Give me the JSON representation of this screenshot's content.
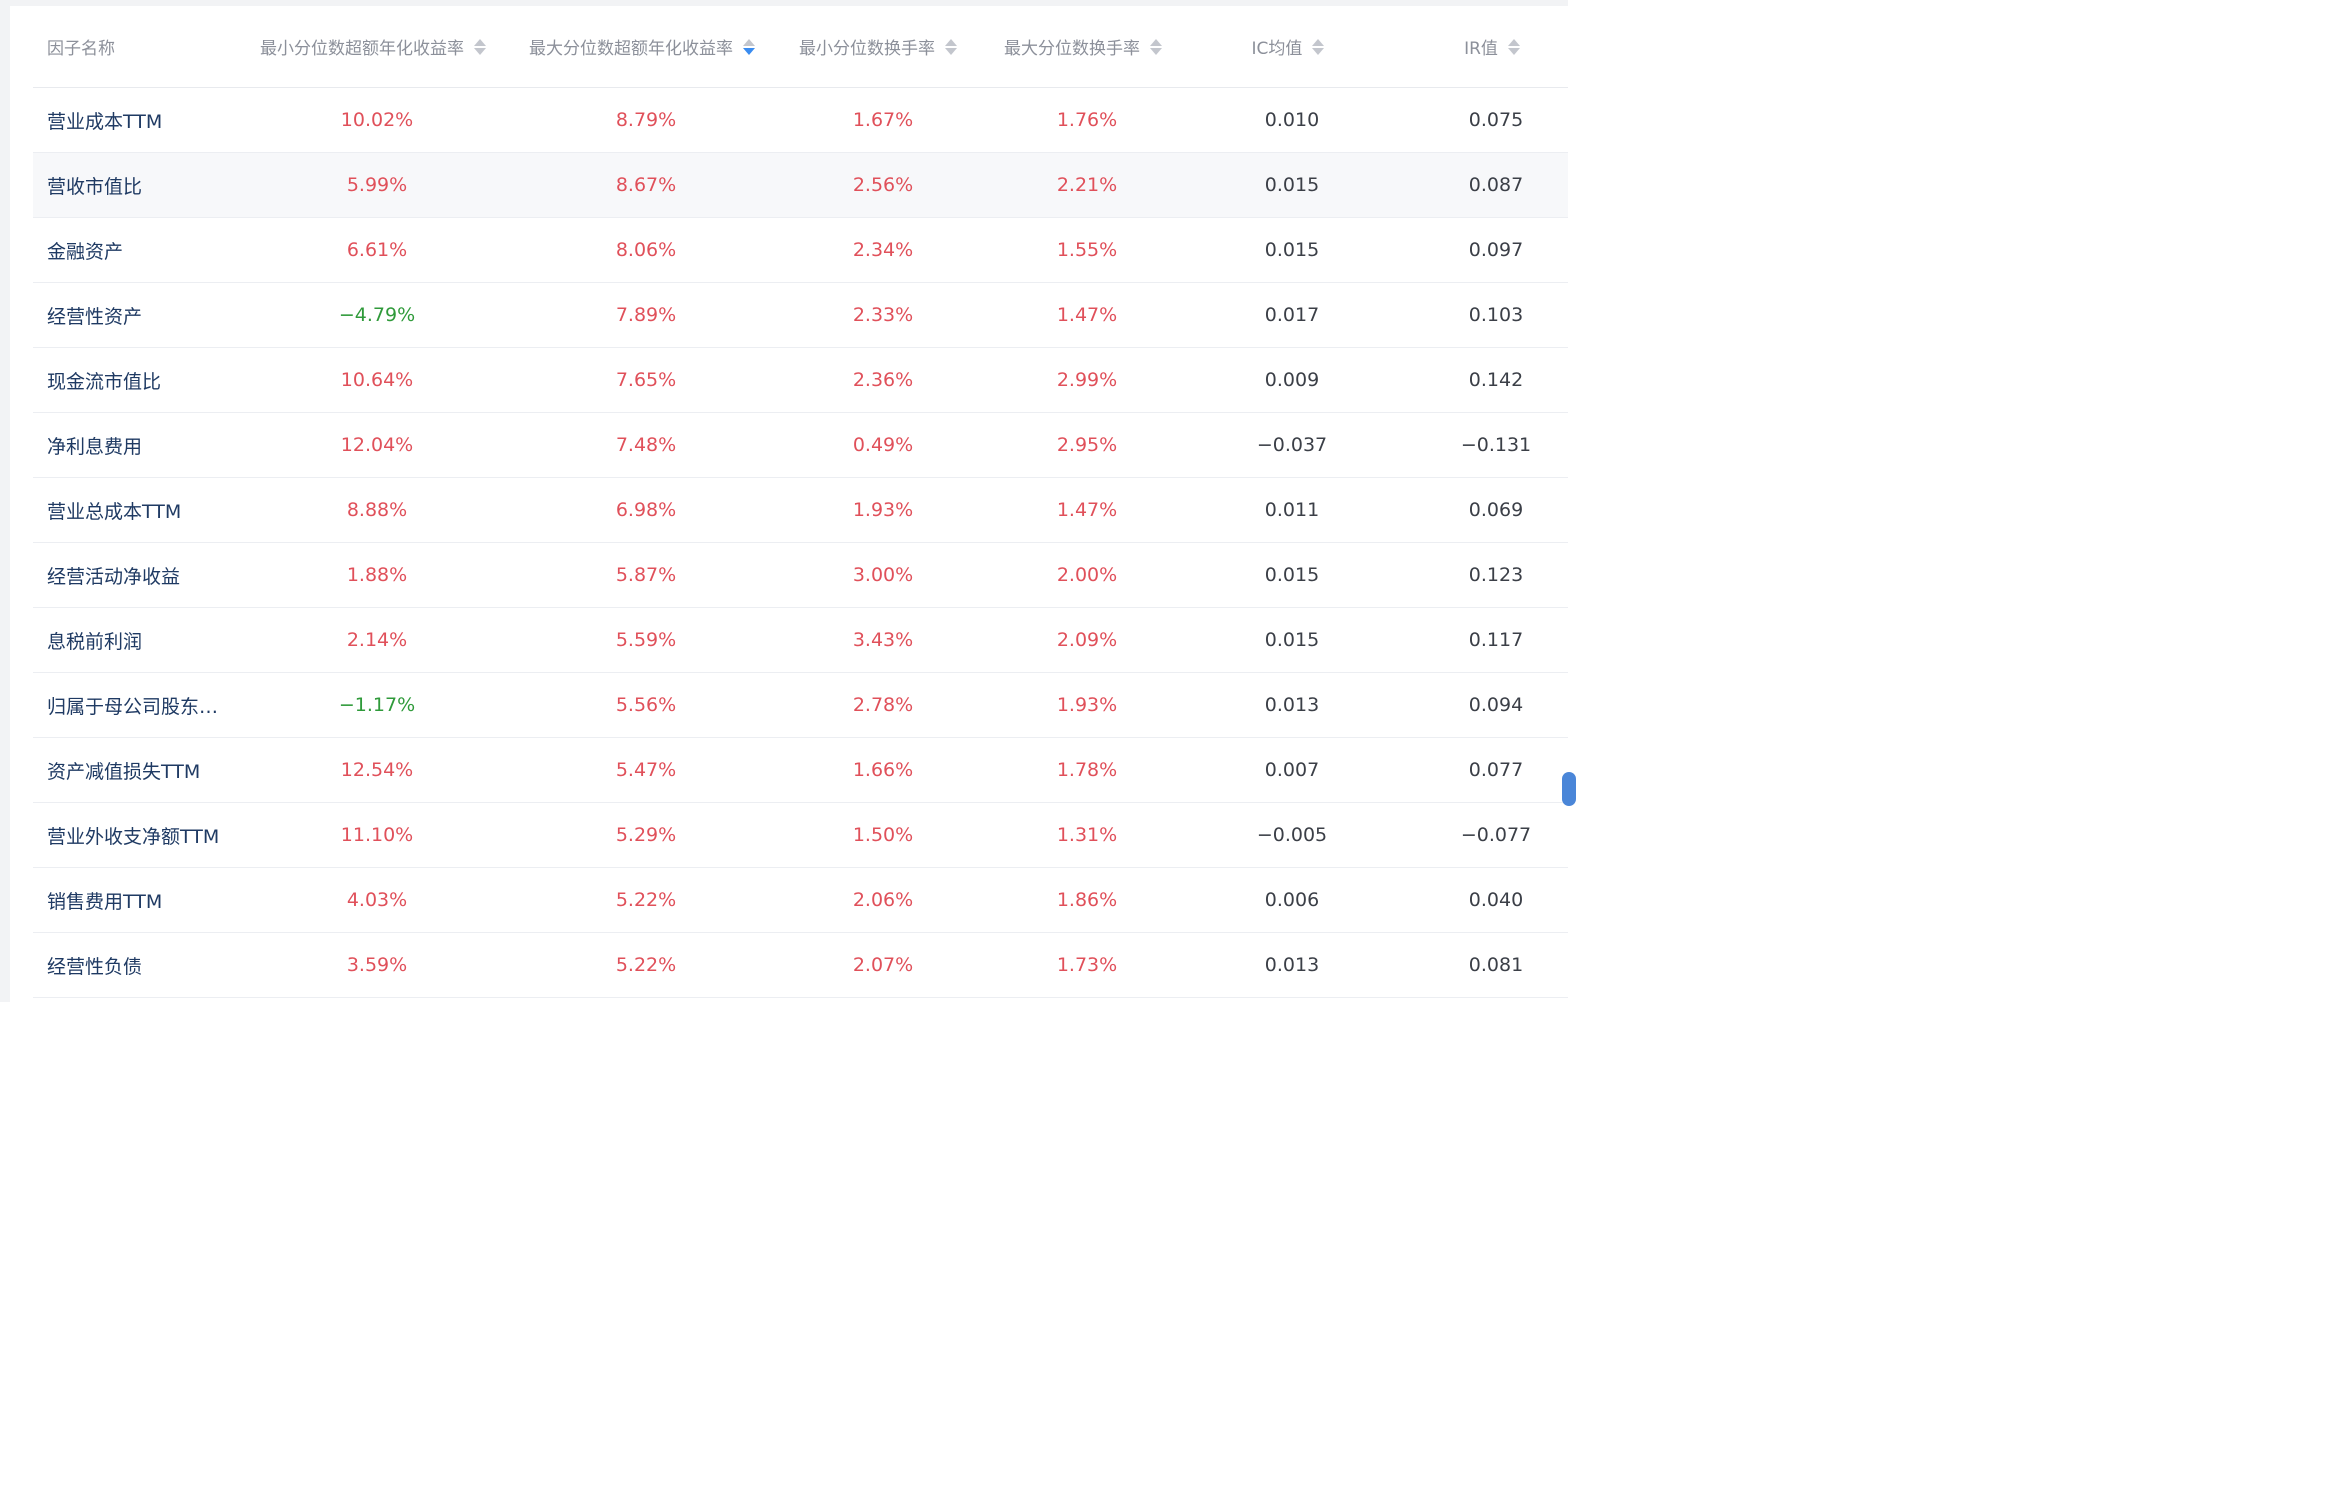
{
  "table": {
    "columns": [
      {
        "key": "name",
        "label": "因子名称",
        "sortable": false
      },
      {
        "key": "min_excess",
        "label": "最小分位数超额年化收益率",
        "sortable": true,
        "sorted": false
      },
      {
        "key": "max_excess",
        "label": "最大分位数超额年化收益率",
        "sortable": true,
        "sorted": true,
        "direction": "desc"
      },
      {
        "key": "min_turnover",
        "label": "最小分位数换手率",
        "sortable": true,
        "sorted": false
      },
      {
        "key": "max_turnover",
        "label": "最大分位数换手率",
        "sortable": true,
        "sorted": false
      },
      {
        "key": "ic_mean",
        "label": "IC均值",
        "sortable": true,
        "sorted": false
      },
      {
        "key": "ir",
        "label": "IR值",
        "sortable": true,
        "sorted": false
      }
    ],
    "rows": [
      {
        "name": "营业成本TTM",
        "min_excess": "10.02%",
        "max_excess": "8.79%",
        "min_turnover": "1.67%",
        "max_turnover": "1.76%",
        "ic_mean": "0.010",
        "ir": "0.075"
      },
      {
        "name": "营收市值比",
        "min_excess": "5.99%",
        "max_excess": "8.67%",
        "min_turnover": "2.56%",
        "max_turnover": "2.21%",
        "ic_mean": "0.015",
        "ir": "0.087"
      },
      {
        "name": "金融资产",
        "min_excess": "6.61%",
        "max_excess": "8.06%",
        "min_turnover": "2.34%",
        "max_turnover": "1.55%",
        "ic_mean": "0.015",
        "ir": "0.097"
      },
      {
        "name": "经营性资产",
        "min_excess": "−4.79%",
        "max_excess": "7.89%",
        "min_turnover": "2.33%",
        "max_turnover": "1.47%",
        "ic_mean": "0.017",
        "ir": "0.103"
      },
      {
        "name": "现金流市值比",
        "min_excess": "10.64%",
        "max_excess": "7.65%",
        "min_turnover": "2.36%",
        "max_turnover": "2.99%",
        "ic_mean": "0.009",
        "ir": "0.142"
      },
      {
        "name": "净利息费用",
        "min_excess": "12.04%",
        "max_excess": "7.48%",
        "min_turnover": "0.49%",
        "max_turnover": "2.95%",
        "ic_mean": "−0.037",
        "ir": "−0.131"
      },
      {
        "name": "营业总成本TTM",
        "min_excess": "8.88%",
        "max_excess": "6.98%",
        "min_turnover": "1.93%",
        "max_turnover": "1.47%",
        "ic_mean": "0.011",
        "ir": "0.069"
      },
      {
        "name": "经营活动净收益",
        "min_excess": "1.88%",
        "max_excess": "5.87%",
        "min_turnover": "3.00%",
        "max_turnover": "2.00%",
        "ic_mean": "0.015",
        "ir": "0.123"
      },
      {
        "name": "息税前利润",
        "min_excess": "2.14%",
        "max_excess": "5.59%",
        "min_turnover": "3.43%",
        "max_turnover": "2.09%",
        "ic_mean": "0.015",
        "ir": "0.117"
      },
      {
        "name": "归属于母公司股东…",
        "min_excess": "−1.17%",
        "max_excess": "5.56%",
        "min_turnover": "2.78%",
        "max_turnover": "1.93%",
        "ic_mean": "0.013",
        "ir": "0.094"
      },
      {
        "name": "资产减值损失TTM",
        "min_excess": "12.54%",
        "max_excess": "5.47%",
        "min_turnover": "1.66%",
        "max_turnover": "1.78%",
        "ic_mean": "0.007",
        "ir": "0.077"
      },
      {
        "name": "营业外收支净额TTM",
        "min_excess": "11.10%",
        "max_excess": "5.29%",
        "min_turnover": "1.50%",
        "max_turnover": "1.31%",
        "ic_mean": "−0.005",
        "ir": "−0.077"
      },
      {
        "name": "销售费用TTM",
        "min_excess": "4.03%",
        "max_excess": "5.22%",
        "min_turnover": "2.06%",
        "max_turnover": "1.86%",
        "ic_mean": "0.006",
        "ir": "0.040"
      },
      {
        "name": "经营性负债",
        "min_excess": "3.59%",
        "max_excess": "5.22%",
        "min_turnover": "2.07%",
        "max_turnover": "1.73%",
        "ic_mean": "0.013",
        "ir": "0.081"
      }
    ]
  },
  "colors": {
    "positive": "#e0505a",
    "negative": "#2f9a3a",
    "neutral": "#3b3f47",
    "name": "#1f3a63",
    "header": "#8c909a",
    "sort_active": "#3a8cf0"
  },
  "icons": {
    "sort": "sort-caret-icon"
  }
}
